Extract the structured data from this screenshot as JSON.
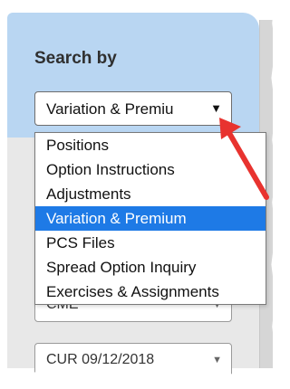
{
  "panel": {
    "heading": "Search by"
  },
  "search_select": {
    "value": "Variation & Premiu",
    "caret": "▼"
  },
  "dropdown": {
    "options": [
      {
        "label": "Positions",
        "selected": false
      },
      {
        "label": "Option Instructions",
        "selected": false
      },
      {
        "label": "Adjustments",
        "selected": false
      },
      {
        "label": "Variation & Premium",
        "selected": true
      },
      {
        "label": "PCS Files",
        "selected": false
      },
      {
        "label": "Spread Option Inquiry",
        "selected": false
      },
      {
        "label": "Exercises & Assignments",
        "selected": false
      }
    ]
  },
  "exchange_select": {
    "value": "CME",
    "caret": "▼"
  },
  "date_select": {
    "value": "CUR 09/12/2018",
    "caret": "▼"
  },
  "colors": {
    "header_band": "#b9d6f2",
    "selected_option": "#1e7ae6",
    "annotation_arrow": "#e8332f"
  }
}
